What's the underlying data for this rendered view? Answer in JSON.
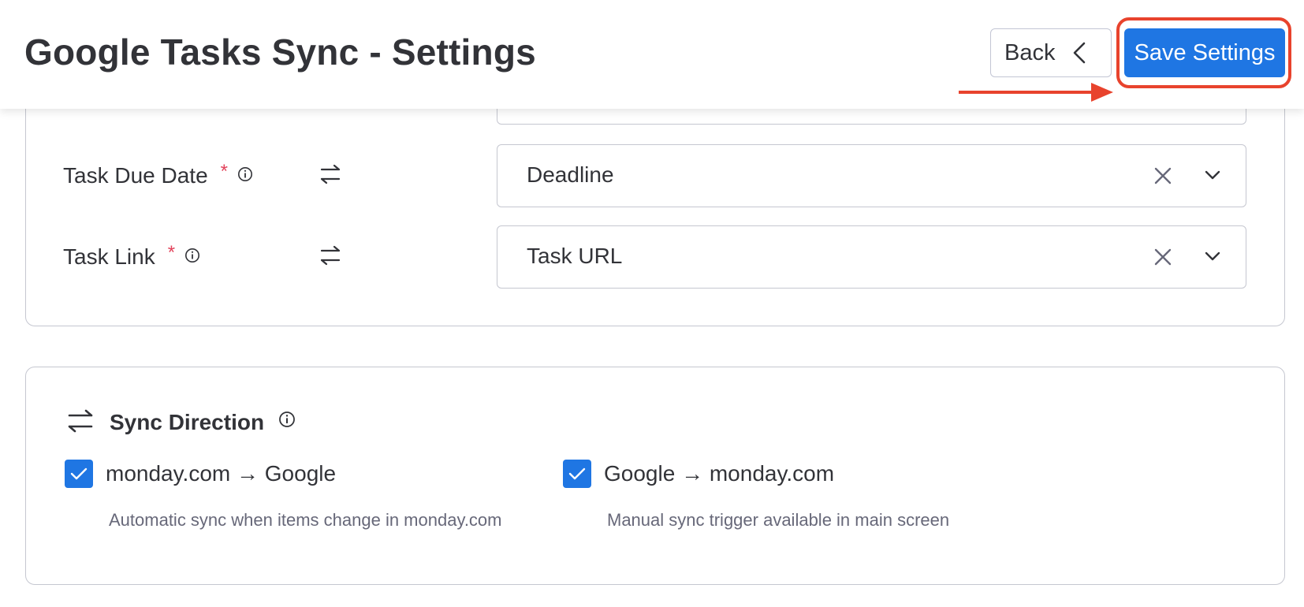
{
  "header": {
    "title": "Google Tasks Sync - Settings",
    "back_label": "Back",
    "save_label": "Save Settings"
  },
  "fields": [
    {
      "label": "Task Due Date",
      "required_mark": "*",
      "value": "Deadline"
    },
    {
      "label": "Task Link",
      "required_mark": "*",
      "value": "Task URL"
    }
  ],
  "sync_direction": {
    "title": "Sync Direction",
    "options": [
      {
        "label": "monday.com → Google",
        "checked": true,
        "description": "Automatic sync when items change in monday.com"
      },
      {
        "label": "Google → monday.com",
        "checked": true,
        "description": "Manual sync trigger available in main screen"
      }
    ]
  },
  "icons": {
    "back": "chevron-left-icon",
    "info": "info-icon",
    "swap": "swap-arrows-icon",
    "clear": "close-icon",
    "dropdown": "chevron-down-icon",
    "checkbox": "check-icon"
  },
  "colors": {
    "primary": "#1f76e3",
    "required": "#e2445c",
    "annotation": "#e8432d",
    "text": "#323338",
    "muted_text": "#676879",
    "border": "#c5c7d0"
  }
}
